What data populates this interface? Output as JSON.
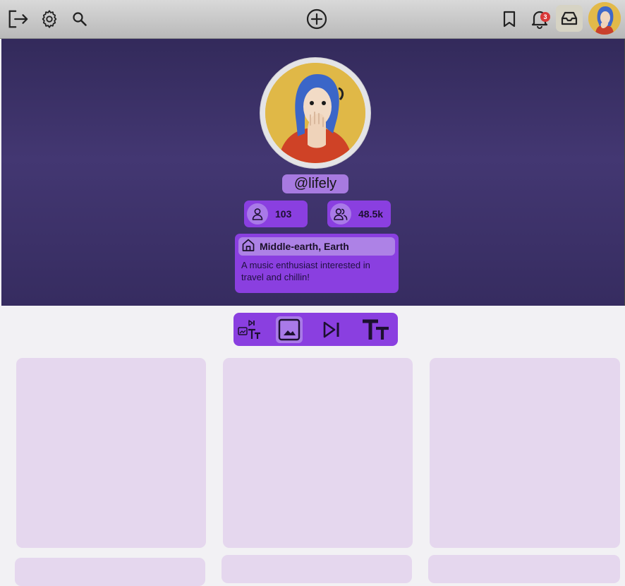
{
  "topbar": {
    "icons": [
      "logout-icon",
      "settings-icon",
      "search-icon",
      "add-post-icon",
      "bookmark-icon",
      "notifications-icon",
      "inbox-icon",
      "user-avatar"
    ],
    "notification_count": "3"
  },
  "profile": {
    "username": "@lifely",
    "following_count": "103",
    "followers_count": "48.5k",
    "location": "Middle-earth, Earth",
    "bio": "A music enthusiast interested in travel and chillin!"
  },
  "content_tabs": {
    "items": [
      "all-posts-tab",
      "images-tab",
      "music-tab",
      "text-tab"
    ],
    "active": "images-tab"
  },
  "colors": {
    "accent": "#8a3fe0",
    "accent_light": "#a97ae8",
    "hero_bg": "#3d3169",
    "tile_bg": "#e5d7ee",
    "page_bg": "#f2f1f4"
  }
}
